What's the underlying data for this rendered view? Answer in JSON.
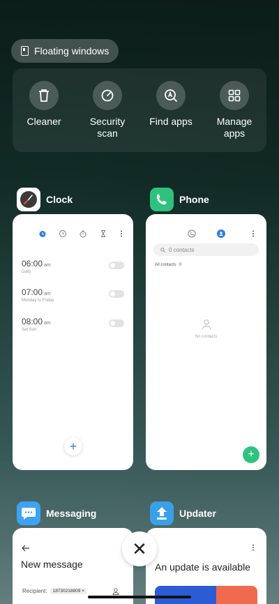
{
  "floating_windows": {
    "label": "Floating windows"
  },
  "tools": [
    {
      "label": "Cleaner",
      "icon": "trash-icon"
    },
    {
      "label": "Security scan",
      "icon": "security-scan-icon"
    },
    {
      "label": "Find apps",
      "icon": "find-apps-icon"
    },
    {
      "label": "Manage apps",
      "icon": "manage-apps-icon"
    }
  ],
  "apps": {
    "clock": {
      "name": "Clock",
      "alarms": [
        {
          "time": "06:00",
          "ampm": "am",
          "repeat": "Daily"
        },
        {
          "time": "07:00",
          "ampm": "am",
          "repeat": "Monday to Friday"
        },
        {
          "time": "08:00",
          "ampm": "am",
          "repeat": "Sat Sun"
        }
      ],
      "add_label": "+"
    },
    "phone": {
      "name": "Phone",
      "search_placeholder": "0 contacts",
      "filter_label": "All contacts",
      "filter_count": "0",
      "empty_label": "No contacts",
      "add_label": "+"
    },
    "messaging": {
      "name": "Messaging",
      "title": "New message",
      "recipient_label": "Recipient:",
      "recipient_value": "18730218809"
    },
    "updater": {
      "name": "Updater",
      "title": "An update is available"
    }
  },
  "close_label": "✕",
  "colors": {
    "phone_icon_bg": "#2ec27e",
    "clock_accent": "#2f7de1",
    "messaging_icon_bg": "#3da3f5",
    "updater_icon_bg": "#3aa0e8"
  }
}
